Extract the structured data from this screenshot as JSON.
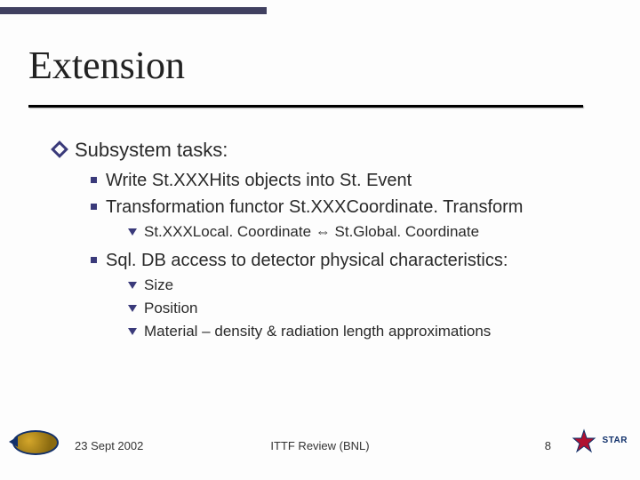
{
  "title": "Extension",
  "body": {
    "heading": "Subsystem tasks:",
    "items": [
      {
        "text": "Write St.XXXHits objects into St. Event"
      },
      {
        "text": "Transformation functor St.XXXCoordinate. Transform",
        "sub": [
          "St.XXXLocal. Coordinate ⇔ St.Global. Coordinate"
        ]
      },
      {
        "text": "Sql. DB access to detector physical characteristics:",
        "sub": [
          "Size",
          "Position",
          "Material – density & radiation length approximations"
        ]
      }
    ]
  },
  "footer": {
    "date": "23 Sept 2002",
    "center": "ITTF Review (BNL)",
    "page": "8",
    "left_logo_alt": "Kent State",
    "right_logo_text": "STAR"
  }
}
